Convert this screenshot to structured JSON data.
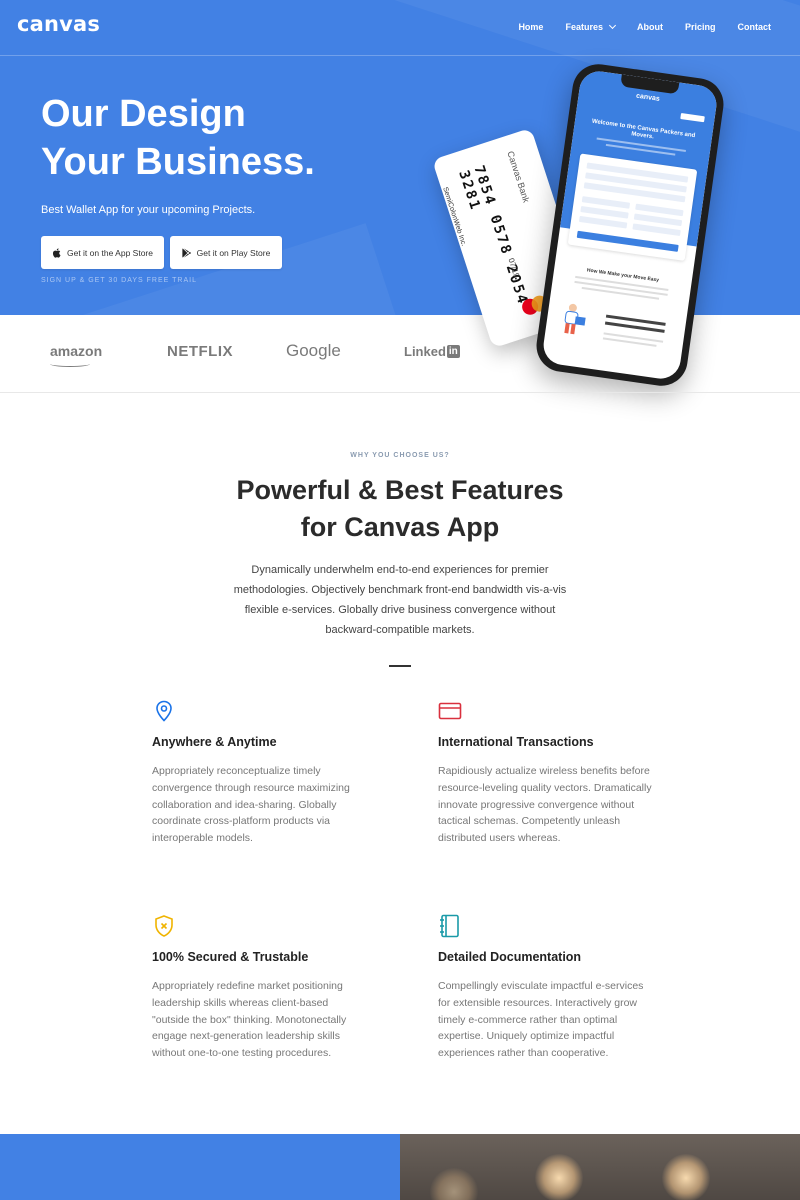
{
  "nav": {
    "logo": "canvas",
    "items": [
      {
        "label": "Home"
      },
      {
        "label": "Features",
        "has_dropdown": true
      },
      {
        "label": "About"
      },
      {
        "label": "Pricing"
      },
      {
        "label": "Contact"
      }
    ]
  },
  "hero": {
    "title_line1": "Our Design",
    "title_line2": "Your Business.",
    "subtitle": "Best Wallet App for your upcoming Projects.",
    "app_store_label": "Get it on the App Store",
    "play_store_label": "Get it on Play Store",
    "trial_note": "SIGN UP & GET 30 DAYS FREE TRAIL",
    "background_color": "#4281e4"
  },
  "card": {
    "bank": "Canvas Bank",
    "number": "7854 0578 2054 3281",
    "holder": "SemiColonWeb Inc.",
    "expiry": "07/19"
  },
  "phone": {
    "logo": "canvas",
    "heading": "Welcome to the Canvas Packers and Movers.",
    "cta": "Contact Us",
    "section_title": "How We Make your Move Easy"
  },
  "brands": [
    "amazon",
    "NETFLIX",
    "Google",
    "Linked"
  ],
  "features_section": {
    "eyebrow": "WHY YOU CHOOSE US?",
    "title_line1": "Powerful & Best Features",
    "title_line2": "for Canvas App",
    "description": "Dynamically underwhelm end-to-end experiences for premier methodologies. Objectively benchmark front-end bandwidth vis-a-vis flexible e-services. Globally drive business convergence without backward-compatible markets.",
    "items": [
      {
        "icon": "location-pin-icon",
        "icon_color": "#1a73e8",
        "title": "Anywhere & Anytime",
        "text": "Appropriately reconceptualize timely convergence through resource maximizing collaboration and idea-sharing. Globally coordinate cross-platform products via interoperable models."
      },
      {
        "icon": "credit-card-icon",
        "icon_color": "#d9303e",
        "title": "International Transactions",
        "text": "Rapidiously actualize wireless benefits before resource-leveling quality vectors. Dramatically innovate progressive convergence without tactical schemas. Competently unleash distributed users whereas."
      },
      {
        "icon": "shield-icon",
        "icon_color": "#f0b400",
        "title": "100% Secured & Trustable",
        "text": "Appropriately redefine market positioning leadership skills whereas client-based \"outside the box\" thinking. Monotonectally engage next-generation leadership skills without one-to-one testing procedures."
      },
      {
        "icon": "notebook-icon",
        "icon_color": "#1a9aa8",
        "title": "Detailed Documentation",
        "text": "Compellingly evisculate impactful e-services for extensible resources. Interactively grow timely e-commerce rather than optimal expertise. Uniquely optimize impactful experiences rather than cooperative."
      }
    ]
  }
}
